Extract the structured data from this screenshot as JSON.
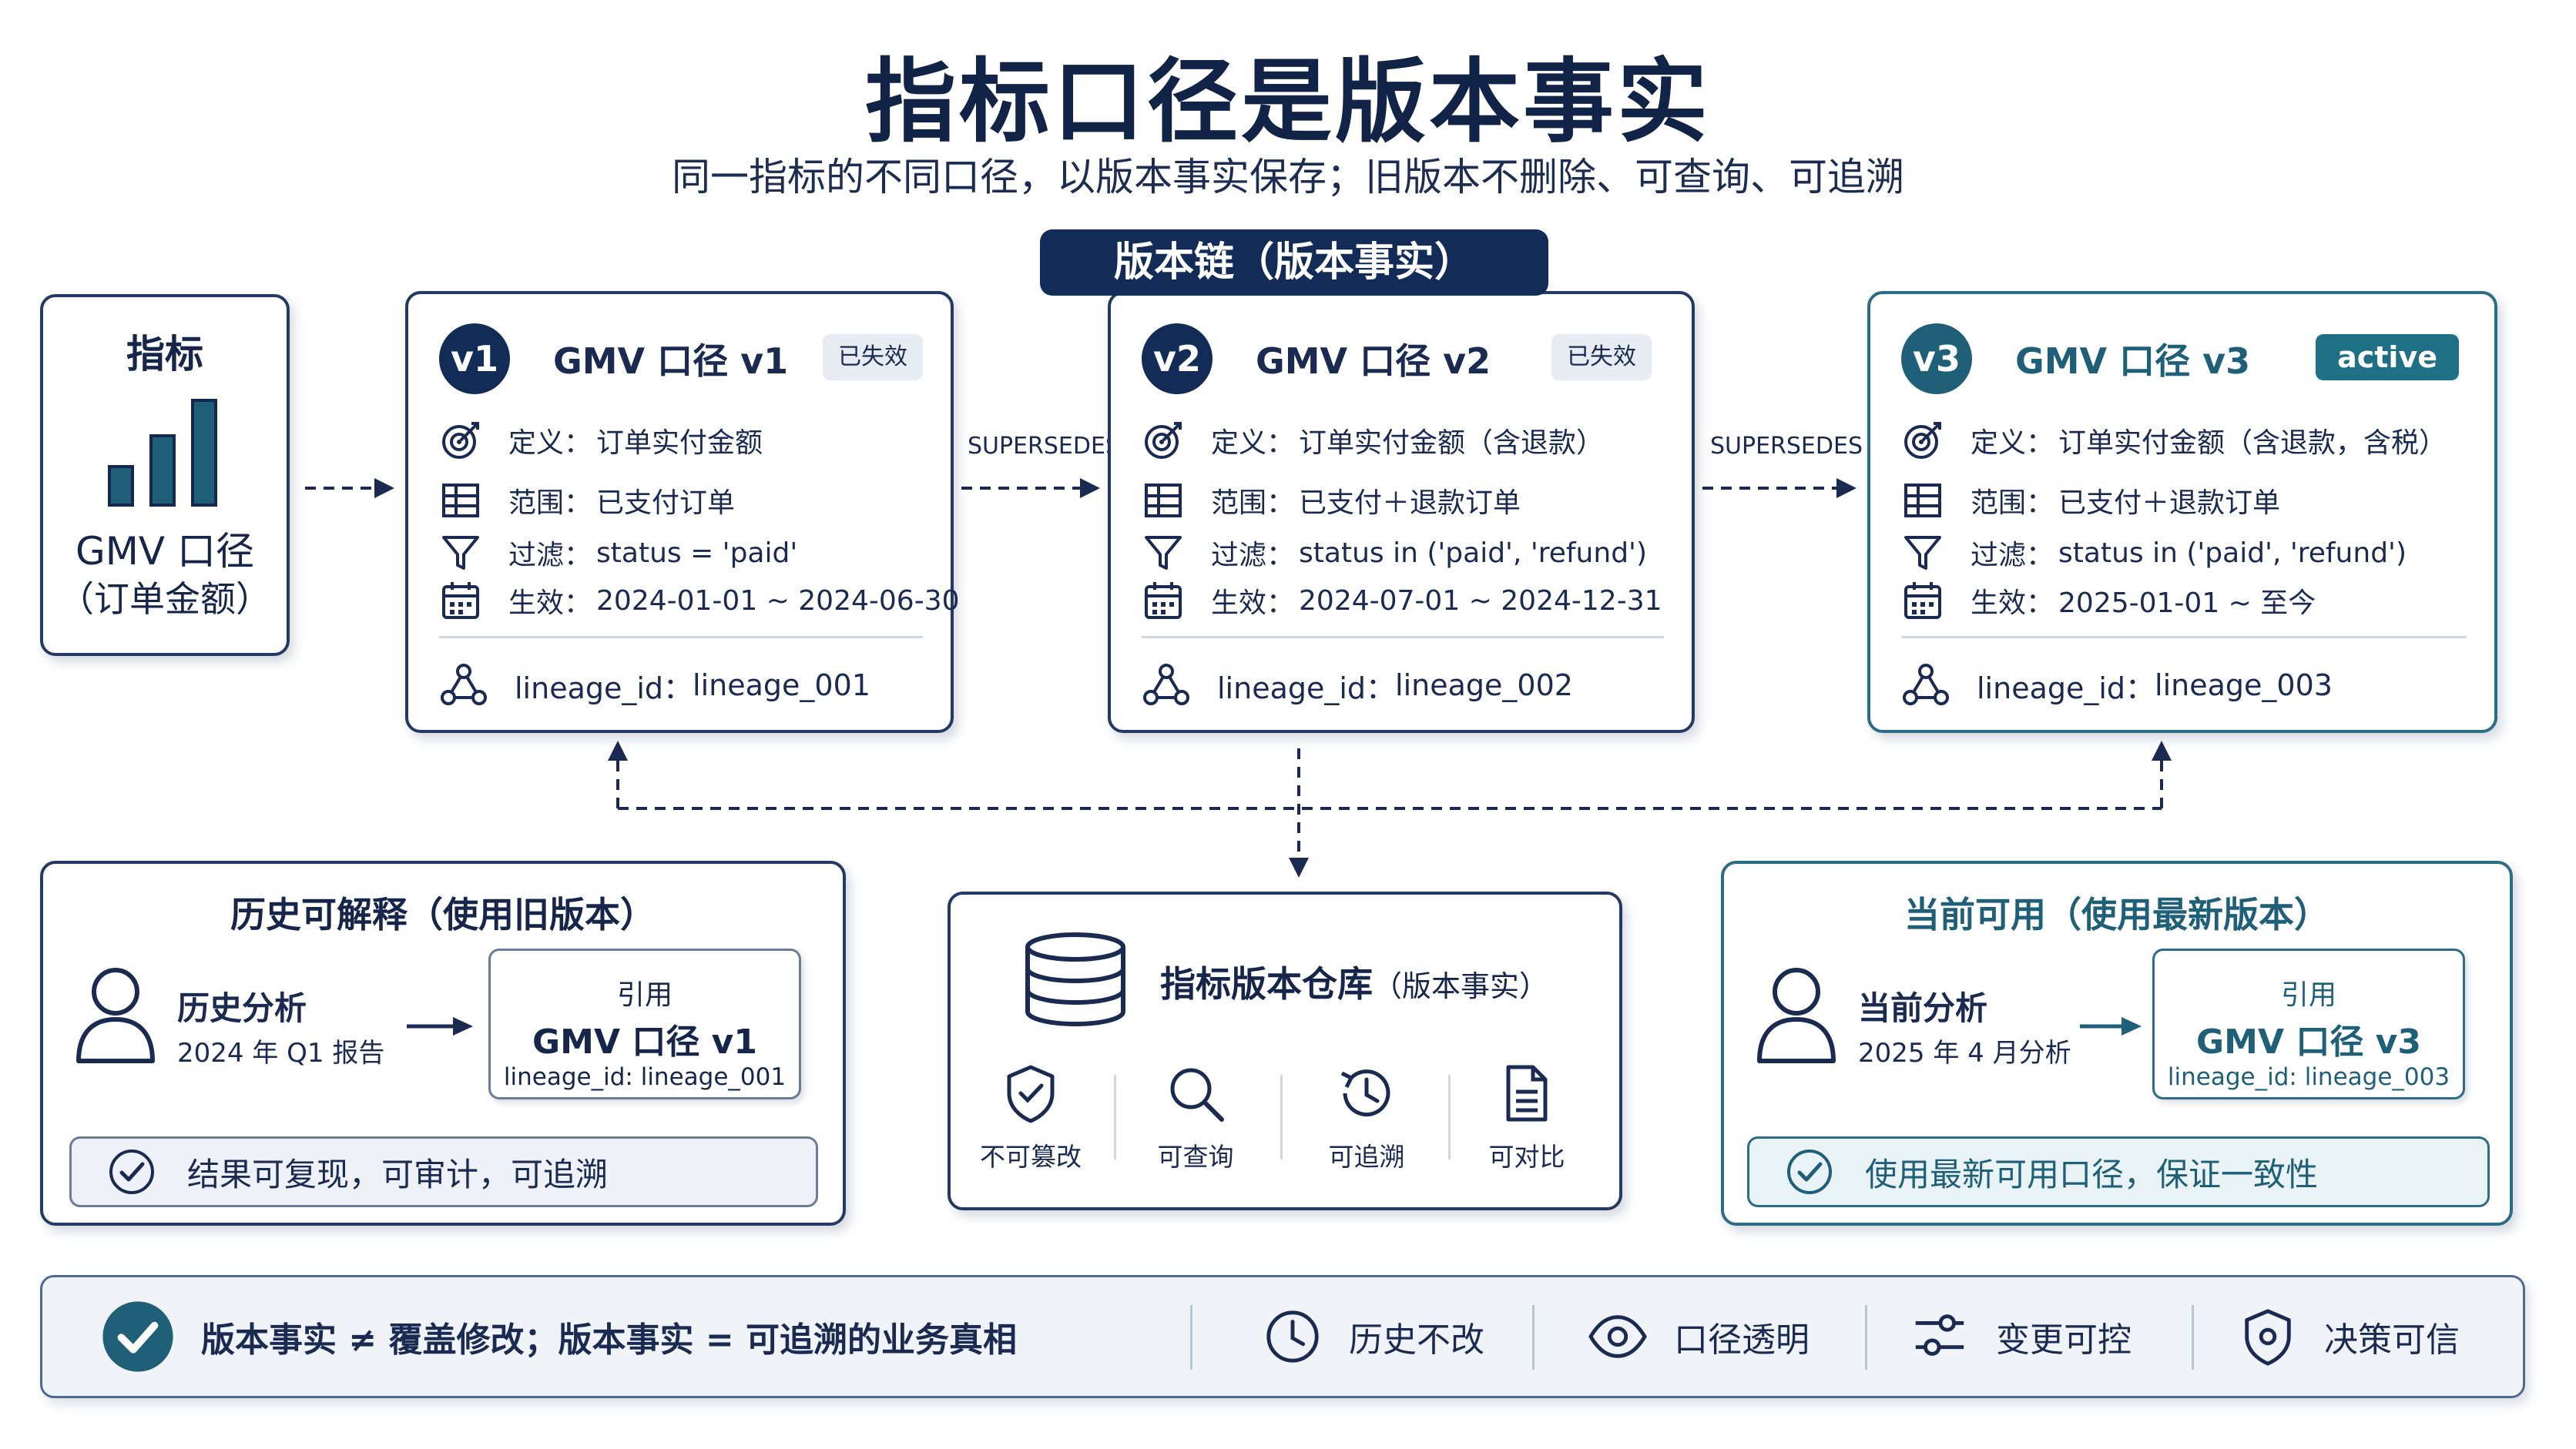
{
  "title": "指标口径是版本事实",
  "subtitle": "同一指标的不同口径，以版本事实保存；旧版本不删除、可查询、可追溯",
  "chain_banner": "版本链（版本事实）",
  "metric": {
    "heading": "指标",
    "name": "GMV 口径",
    "desc": "（订单金额）",
    "icon": "bar-chart-icon"
  },
  "relation_label": "SUPERSEDES",
  "versions": [
    {
      "badge": "v1",
      "name": "GMV 口径 v1",
      "status": "已失效",
      "definition_label": "定义：",
      "definition": "订单实付金额",
      "scope_label": "范围：",
      "scope": "已支付订单",
      "filter_label": "过滤：",
      "filter": "status = 'paid'",
      "effective_label": "生效：",
      "effective": "2024-01-01 ~ 2024-06-30",
      "lineage_label": "lineage_id：",
      "lineage": "lineage_001"
    },
    {
      "badge": "v2",
      "name": "GMV 口径 v2",
      "status": "已失效",
      "definition_label": "定义：",
      "definition": "订单实付金额（含退款）",
      "scope_label": "范围：",
      "scope": "已支付＋退款订单",
      "filter_label": "过滤：",
      "filter": "status in ('paid', 'refund')",
      "effective_label": "生效：",
      "effective": "2024-07-01 ~ 2024-12-31",
      "lineage_label": "lineage_id：",
      "lineage": "lineage_002"
    },
    {
      "badge": "v3",
      "name": "GMV 口径 v3",
      "status": "active",
      "definition_label": "定义：",
      "definition": "订单实付金额（含退款，含税）",
      "scope_label": "范围：",
      "scope": "已支付＋退款订单",
      "filter_label": "过滤：",
      "filter": "status in ('paid', 'refund')",
      "effective_label": "生效：",
      "effective": "2025-01-01 ~ 至今",
      "lineage_label": "lineage_id：",
      "lineage": "lineage_003"
    }
  ],
  "history": {
    "title": "历史可解释（使用旧版本）",
    "analysis_title": "历史分析",
    "analysis_sub": "2024 年 Q1 报告",
    "ref_label": "引用",
    "ref_name": "GMV 口径 v1",
    "ref_lineage": "lineage_id: lineage_001",
    "result": "结果可复现，可审计，可追溯"
  },
  "repository": {
    "title": "指标版本仓库",
    "title_paren": "（版本事实）",
    "features": [
      {
        "icon": "shield-check-icon",
        "label": "不可篡改"
      },
      {
        "icon": "search-icon",
        "label": "可查询"
      },
      {
        "icon": "history-clock-icon",
        "label": "可追溯"
      },
      {
        "icon": "document-icon",
        "label": "可对比"
      }
    ]
  },
  "current": {
    "title": "当前可用（使用最新版本）",
    "analysis_title": "当前分析",
    "analysis_sub": "2025 年 4 月分析",
    "ref_label": "引用",
    "ref_name": "GMV 口径 v3",
    "ref_lineage": "lineage_id: lineage_003",
    "result": "使用最新可用口径，保证一致性"
  },
  "footer": {
    "statement": "版本事实 ≠ 覆盖修改；版本事实 = 可追溯的业务真相",
    "items": [
      {
        "icon": "clock-icon",
        "label": "历史不改"
      },
      {
        "icon": "eye-icon",
        "label": "口径透明"
      },
      {
        "icon": "sliders-icon",
        "label": "变更可控"
      },
      {
        "icon": "shield-icon",
        "label": "决策可信"
      }
    ]
  },
  "colors": {
    "navy": "#122b57",
    "teal": "#1f6f85",
    "border": "#243a64"
  }
}
